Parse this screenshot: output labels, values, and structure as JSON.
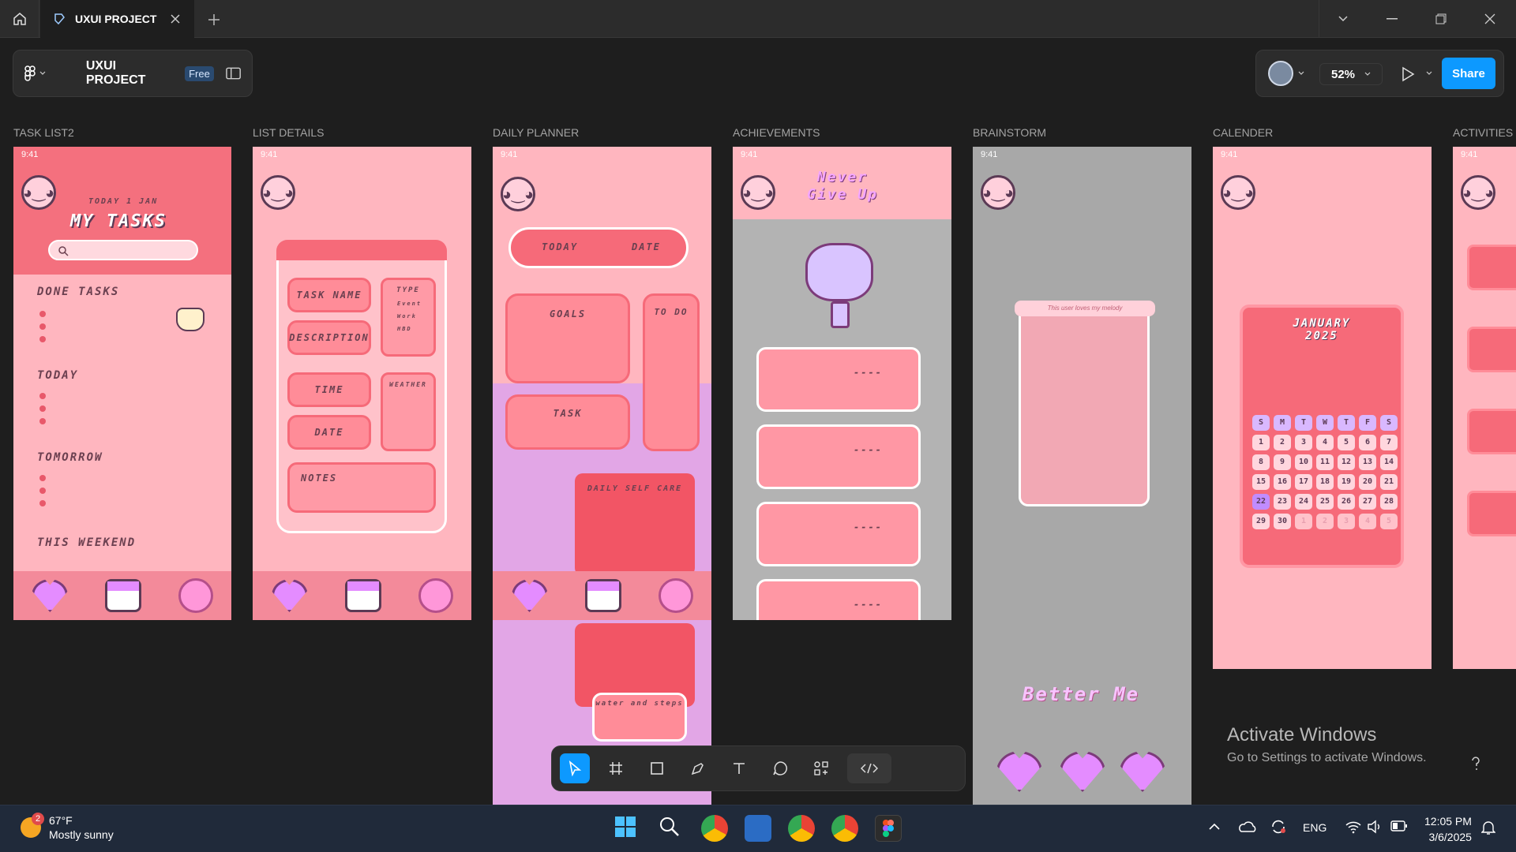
{
  "tab": {
    "title": "UXUI PROJECT"
  },
  "toolbar": {
    "project_name": "UXUI PROJECT",
    "plan_badge": "Free",
    "zoom": "52%",
    "share_label": "Share"
  },
  "frames": [
    {
      "label": "TASK LIST2",
      "status_time": "9:41"
    },
    {
      "label": "LIST DETAILS",
      "status_time": "9:41"
    },
    {
      "label": "DAILY PLANNER",
      "status_time": "9:41"
    },
    {
      "label": "ACHIEVEMENTS",
      "status_time": "9:41"
    },
    {
      "label": "BRAINSTORM",
      "status_time": "9:41"
    },
    {
      "label": "CALENDER",
      "status_time": "9:41"
    },
    {
      "label": "ACTIVITIES",
      "status_time": "9:41"
    }
  ],
  "task_list": {
    "date": "TODAY 1 JAN",
    "heading": "MY TASKS",
    "sections": [
      "DONE TASKS",
      "TODAY",
      "TOMORROW",
      "THIS WEEKEND"
    ]
  },
  "list_details": {
    "task_name": "TASK NAME",
    "description": "DESCRIPTION",
    "time": "TIME",
    "date": "DATE",
    "notes": "NOTES",
    "type": "TYPE",
    "type_options": [
      "Event",
      "Work",
      "HBD"
    ],
    "weather": "WEATHER"
  },
  "daily_planner": {
    "today": "TODAY",
    "date": "DATE",
    "goals": "GOALS",
    "todo": "TO DO",
    "task": "TASK",
    "self_care": "DAILY SELF CARE",
    "water": "water and steps"
  },
  "achievements": {
    "motto": "Never Give Up",
    "scores": [
      "----",
      "----",
      "----",
      "----"
    ]
  },
  "brainstorm": {
    "banner": "This user loves my melody",
    "footer": "Better Me"
  },
  "calendar": {
    "month": "JANUARY",
    "year": "2025",
    "weekdays": [
      "S",
      "M",
      "T",
      "W",
      "T",
      "F",
      "S"
    ],
    "days": [
      "1",
      "2",
      "3",
      "4",
      "5",
      "6",
      "7",
      "8",
      "9",
      "10",
      "11",
      "12",
      "13",
      "14",
      "15",
      "16",
      "17",
      "18",
      "19",
      "20",
      "21",
      "22",
      "23",
      "24",
      "25",
      "26",
      "27",
      "28",
      "29",
      "30",
      "1",
      "2",
      "3",
      "4",
      "5"
    ]
  },
  "watermark": {
    "title": "Activate Windows",
    "subtitle": "Go to Settings to activate Windows."
  },
  "taskbar": {
    "badge": "2",
    "temperature": "67°F",
    "condition": "Mostly sunny",
    "language": "ENG",
    "time": "12:05 PM",
    "date": "3/6/2025"
  },
  "colors": {
    "accent": "#0d99ff",
    "frame_pink": "#ffb6bf",
    "rose": "#f66a79",
    "canvas": "#1e1e1e"
  }
}
